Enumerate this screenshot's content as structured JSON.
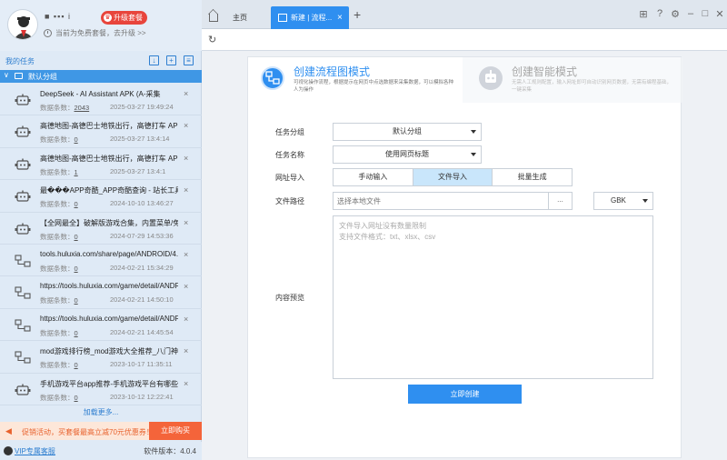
{
  "profile": {
    "username": "■  ▪▪▪ i",
    "upgrade_label": "升级套餐",
    "plan_text": "当前为免费套餐，去升级 >>"
  },
  "tasks": {
    "title": "我的任务",
    "group_name": "默认分组",
    "count_label": "数据条数：",
    "items": [
      {
        "name": "DeepSeek - AI Assistant APK (A-采集",
        "count": "2043",
        "date": "2025-03-27 19:49:24",
        "icon": "robot-icon"
      },
      {
        "name": "高德地图-高德巴士地铁出行，高德打车 APK",
        "count": "0",
        "date": "2025-03-27 13:4:14",
        "icon": "robot-icon"
      },
      {
        "name": "高德地图-高德巴士地铁出行，高德打车 APK",
        "count": "1",
        "date": "2025-03-27 13:4:1",
        "icon": "robot-icon"
      },
      {
        "name": "最���APP奇酷_APP奇酷查询 - 站长工具",
        "count": "0",
        "date": "2024-10-10 13:46:27",
        "icon": "robot-icon"
      },
      {
        "name": "【全网最全】破解版游戏合集，内置菜单/免",
        "count": "0",
        "date": "2024-07-29 14:53:36",
        "icon": "robot-icon"
      },
      {
        "name": "tools.huluxia.com/share/page/ANDROID/4...",
        "count": "0",
        "date": "2024-02-21 15:34:29",
        "icon": "flow-icon"
      },
      {
        "name": "https://tools.huluxia.com/game/detail/ANDR...",
        "count": "0",
        "date": "2024-02-21 14:50:10",
        "icon": "flow-icon"
      },
      {
        "name": "https://tools.huluxia.com/game/detail/ANDR...",
        "count": "0",
        "date": "2024-02-21 14:45:54",
        "icon": "flow-icon"
      },
      {
        "name": "mod游戏排行榜_mod游戏大全推荐_八门神...",
        "count": "0",
        "date": "2023-10-17 11:35:11",
        "icon": "flow-icon"
      },
      {
        "name": "手机游戏平台app推荐-手机游戏平台有哪些...",
        "count": "0",
        "date": "2023-10-12 12:22:41",
        "icon": "robot-icon"
      }
    ],
    "load_more": "加载更多..."
  },
  "promo": {
    "text": "促销活动，买套餐最高立减70元优惠券！",
    "button": "立即购买"
  },
  "footer": {
    "vip": "VIP专属客服",
    "version": "软件版本：4.0.4"
  },
  "tabs": {
    "home": "主页",
    "active": "新建 | 流程..."
  },
  "modes": {
    "flow": {
      "title": "创建流程图模式",
      "desc": "可视化操作流程，根据提示在网页中点选数据来采集数据，可以模拟各种人为操作"
    },
    "smart": {
      "title": "创建智能模式",
      "desc": "无需人工规则配置，输入网址即可自动识别网页数据，无需有编程基础，一键采集"
    }
  },
  "form": {
    "group_label": "任务分组",
    "group_value": "默认分组",
    "name_label": "任务名称",
    "name_value": "使用网页标题",
    "url_label": "网址导入",
    "url_options": [
      "手动输入",
      "文件导入",
      "批量生成"
    ],
    "path_label": "文件路径",
    "path_placeholder": "选择本地文件",
    "browse": "...",
    "encoding": "GBK",
    "preview_label": "内容预览",
    "preview_line1": "文件导入网址没有数量限制",
    "preview_line2": "支持文件格式：txt、xlsx、csv",
    "create_button": "立即创建"
  },
  "colors": {
    "accent": "#2f8ff0",
    "upgrade": "#e8453c",
    "promo": "#f4643a"
  }
}
